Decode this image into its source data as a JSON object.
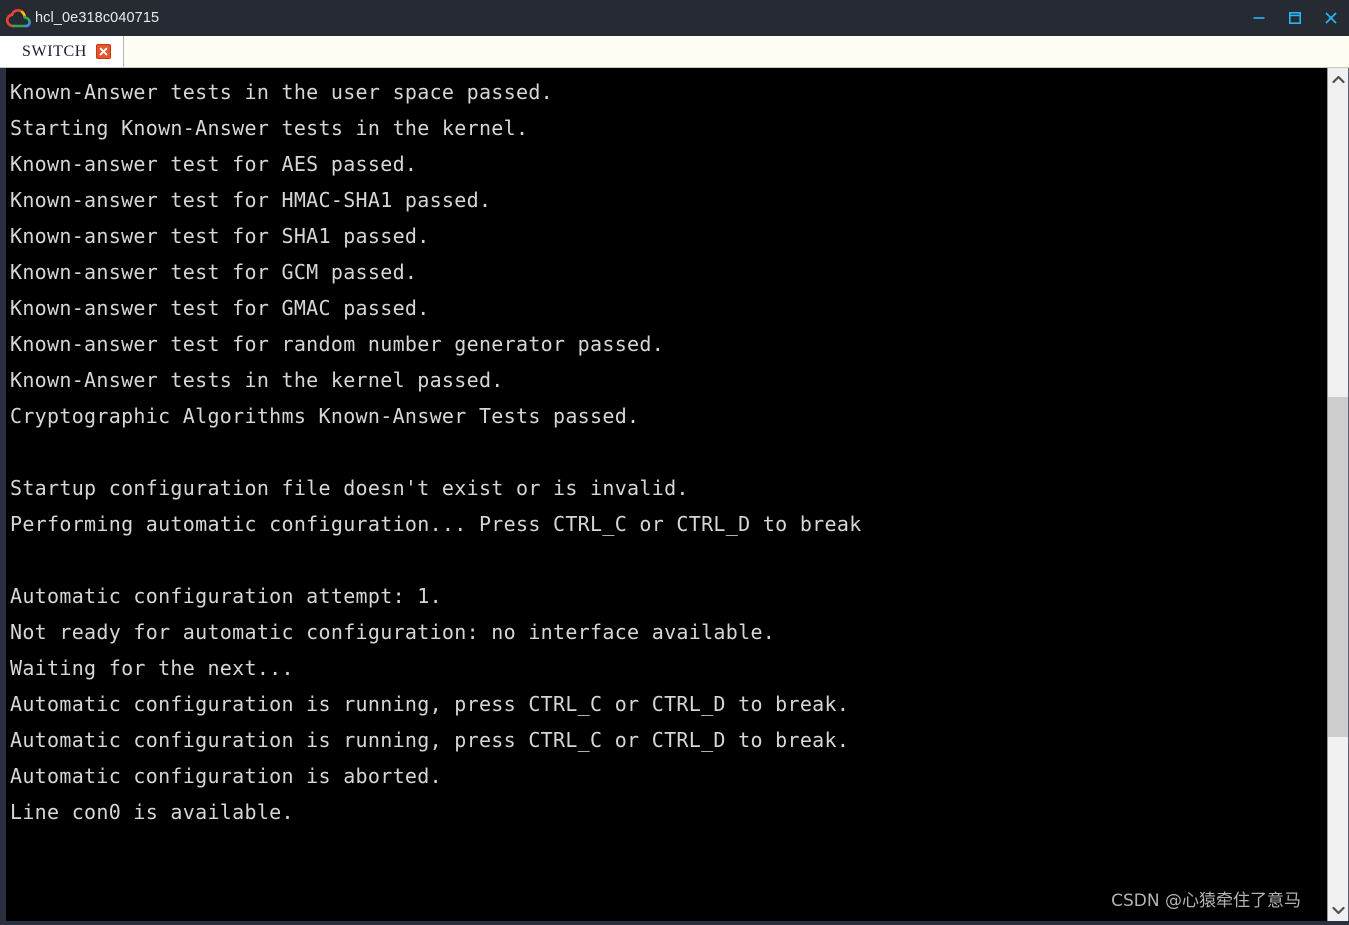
{
  "window": {
    "title": "hcl_0e318c040715",
    "icon": "cloud-icon",
    "controls": {
      "minimize_label": "Minimize",
      "maximize_label": "Maximize",
      "close_label": "Close"
    }
  },
  "tabs": [
    {
      "label": "SWITCH",
      "active": true,
      "close_label": "Close tab"
    }
  ],
  "terminal": {
    "lines": [
      "Known-Answer tests in the user space passed.",
      "Starting Known-Answer tests in the kernel.",
      "Known-answer test for AES passed.",
      "Known-answer test for HMAC-SHA1 passed.",
      "Known-answer test for SHA1 passed.",
      "Known-answer test for GCM passed.",
      "Known-answer test for GMAC passed.",
      "Known-answer test for random number generator passed.",
      "Known-Answer tests in the kernel passed.",
      "Cryptographic Algorithms Known-Answer Tests passed.",
      "",
      "Startup configuration file doesn't exist or is invalid.",
      "Performing automatic configuration... Press CTRL_C or CTRL_D to break",
      "",
      "Automatic configuration attempt: 1.",
      "Not ready for automatic configuration: no interface available.",
      "Waiting for the next...",
      "Automatic configuration is running, press CTRL_C or CTRL_D to break.",
      "Automatic configuration is running, press CTRL_C or CTRL_D to break.",
      "Automatic configuration is aborted.",
      "Line con0 is available."
    ],
    "background_color": "#000000",
    "text_color": "#d6d6d6"
  },
  "scrollbar": {
    "up_arrow": "chevron-up-icon",
    "down_arrow": "chevron-down-icon",
    "thumb_top_percent": 38,
    "thumb_height_percent": 42
  },
  "watermark": {
    "text": "CSDN @心猿牵住了意马"
  },
  "colors": {
    "titlebar": "#252a33",
    "tabbar": "#fdfdf2",
    "accent": "#29b6f6",
    "tab_close": "#e8552d",
    "terminal_bg": "#000000"
  }
}
